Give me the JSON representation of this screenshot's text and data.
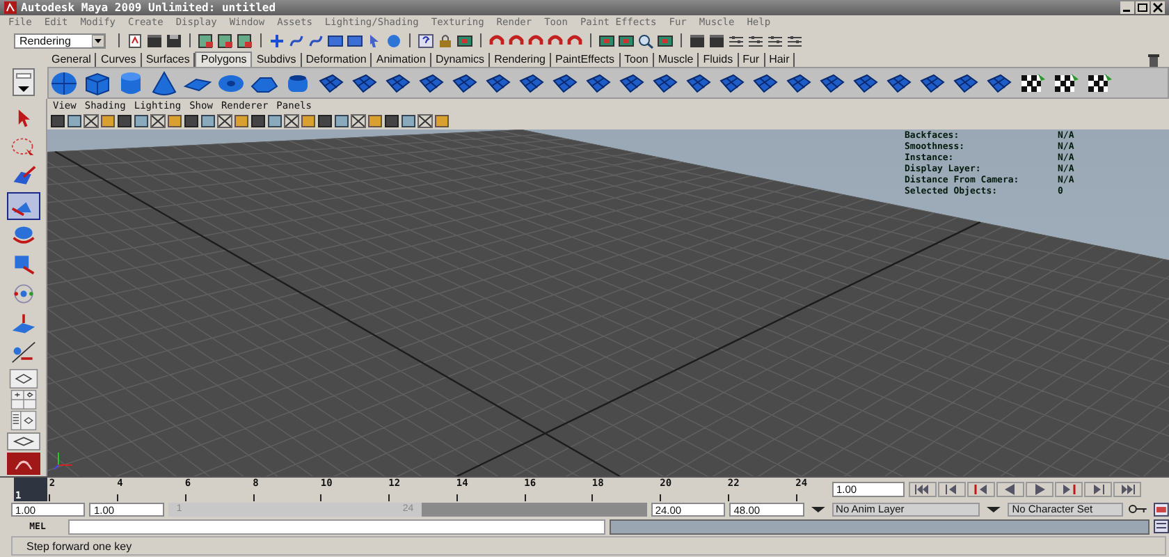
{
  "window": {
    "title": "Autodesk Maya 2009 Unlimited: untitled"
  },
  "menu_bar": [
    "File",
    "Edit",
    "Modify",
    "Create",
    "Display",
    "Window",
    "Assets",
    "Lighting/Shading",
    "Texturing",
    "Render",
    "Toon",
    "Paint Effects",
    "Fur",
    "Muscle",
    "Help"
  ],
  "status_line": {
    "menu_set": "Rendering"
  },
  "shelf_tabs": [
    {
      "label": "General",
      "selected": false
    },
    {
      "label": "Curves",
      "selected": false
    },
    {
      "label": "Surfaces",
      "selected": false
    },
    {
      "label": "Polygons",
      "selected": true
    },
    {
      "label": "Subdivs",
      "selected": false
    },
    {
      "label": "Deformation",
      "selected": false
    },
    {
      "label": "Animation",
      "selected": false
    },
    {
      "label": "Dynamics",
      "selected": false
    },
    {
      "label": "Rendering",
      "selected": false
    },
    {
      "label": "PaintEffects",
      "selected": false
    },
    {
      "label": "Toon",
      "selected": false
    },
    {
      "label": "Muscle",
      "selected": false
    },
    {
      "label": "Fluids",
      "selected": false
    },
    {
      "label": "Fur",
      "selected": false
    },
    {
      "label": "Hair",
      "selected": false
    }
  ],
  "panel_menu": [
    "View",
    "Shading",
    "Lighting",
    "Show",
    "Renderer",
    "Panels"
  ],
  "toolbox": [
    {
      "kind": "select",
      "selected": false
    },
    {
      "kind": "lasso",
      "selected": false
    },
    {
      "kind": "paint",
      "selected": false
    },
    {
      "kind": "move",
      "selected": true
    },
    {
      "kind": "rotate",
      "selected": false
    },
    {
      "kind": "scale",
      "selected": false
    },
    {
      "kind": "manip",
      "selected": false
    },
    {
      "kind": "soft",
      "selected": false
    },
    {
      "kind": "last",
      "selected": false
    }
  ],
  "heads_up_display": [
    {
      "label": "Backfaces:",
      "value": "N/A"
    },
    {
      "label": "Smoothness:",
      "value": "N/A"
    },
    {
      "label": "Instance:",
      "value": "N/A"
    },
    {
      "label": "Display Layer:",
      "value": "N/A"
    },
    {
      "label": "Distance From Camera:",
      "value": "N/A"
    },
    {
      "label": "Selected Objects:",
      "value": "0"
    }
  ],
  "time_slider": {
    "ticks": [
      "2",
      "4",
      "6",
      "8",
      "10",
      "12",
      "14",
      "16",
      "18",
      "20",
      "22",
      "24"
    ],
    "current_frame": "1",
    "level": 0
  },
  "current_frame_field": "1.00",
  "range_slider": {
    "level": 0.53,
    "start": "1.00",
    "playback_start": "1.00",
    "range_start": "1",
    "range_end": "24",
    "playback_end": "24.00",
    "end": "48.00"
  },
  "anim_layer": "No Anim Layer",
  "character_set": "No Character Set",
  "command_line": {
    "label": "MEL"
  },
  "help_line": "Step forward one key"
}
